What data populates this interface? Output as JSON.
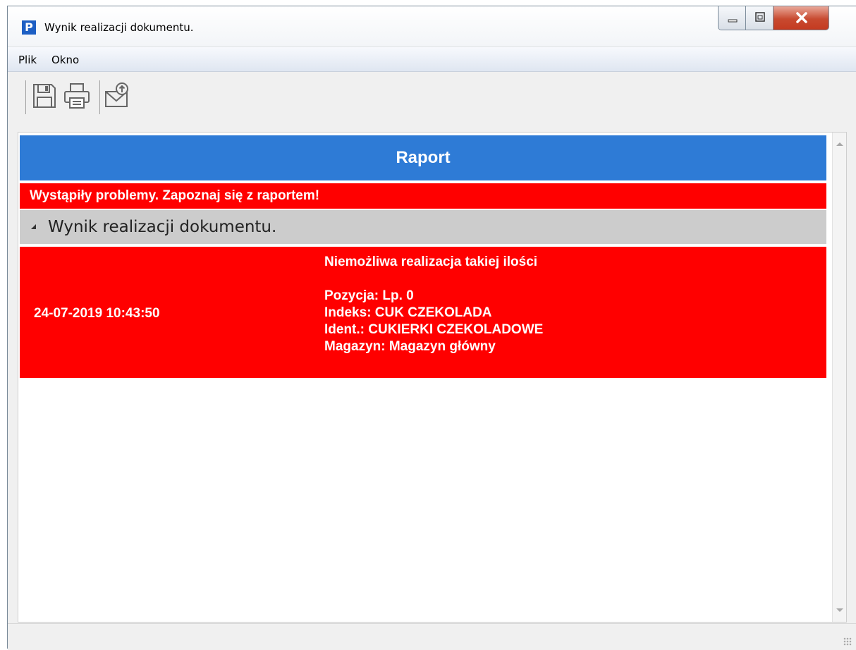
{
  "window": {
    "title": "Wynik realizacji dokumentu.",
    "app_icon_letter": "P",
    "controls": [
      "minimize-icon",
      "maximize-icon",
      "close-icon"
    ]
  },
  "menu": {
    "items": [
      {
        "label": "Plik"
      },
      {
        "label": "Okno"
      }
    ]
  },
  "toolbar": {
    "buttons": [
      "save-icon",
      "print-icon",
      "email-send-icon"
    ]
  },
  "report": {
    "header": "Raport",
    "warning": "Wystąpiły problemy. Zapoznaj się z raportem!",
    "section_title": "Wynik realizacji dokumentu.",
    "entries": [
      {
        "timestamp": "24-07-2019 10:43:50",
        "message": "Niemożliwa realizacja takiej ilości\n\nPozycja: Lp. 0\nIndeks: CUK CZEKOLADA\nIdent.: CUKIERKI CZEKOLADOWE\nMagazyn: Magazyn główny"
      }
    ]
  },
  "colors": {
    "header_blue": "#2e7bd6",
    "error_red": "#ff0000",
    "section_gray": "#cccccc"
  }
}
